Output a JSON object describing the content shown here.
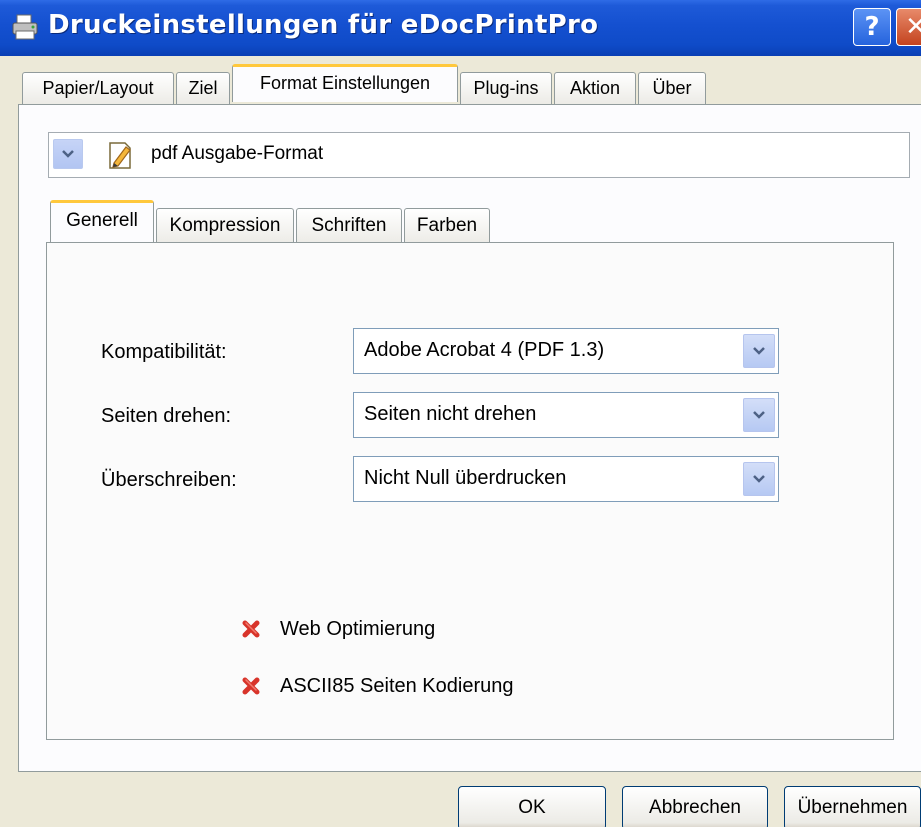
{
  "window": {
    "title": "Druckeinstellungen für eDocPrintPro",
    "help_label": "?",
    "close_label": "✕"
  },
  "outer_tabs": [
    {
      "label": "Papier/Layout",
      "active": false
    },
    {
      "label": "Ziel",
      "active": false
    },
    {
      "label": "Format Einstellungen",
      "active": true
    },
    {
      "label": "Plug-ins",
      "active": false
    },
    {
      "label": "Aktion",
      "active": false
    },
    {
      "label": "Über",
      "active": false
    }
  ],
  "format_selector": {
    "label": "pdf Ausgabe-Format",
    "icon": "pdf-edit-icon"
  },
  "inner_tabs": [
    {
      "label": "Generell",
      "active": true
    },
    {
      "label": "Kompression",
      "active": false
    },
    {
      "label": "Schriften",
      "active": false
    },
    {
      "label": "Farben",
      "active": false
    }
  ],
  "fields": {
    "compat": {
      "label": "Kompatibilität:",
      "value": "Adobe Acrobat 4 (PDF 1.3)"
    },
    "rotate": {
      "label": "Seiten drehen:",
      "value": "Seiten nicht drehen"
    },
    "overprint": {
      "label": "Überschreiben:",
      "value": "Nicht Null überdrucken"
    }
  },
  "options": {
    "web": {
      "label": "Web Optimierung",
      "state": "disabled",
      "icon": "red-x-icon"
    },
    "ascii": {
      "label": "ASCII85 Seiten Kodierung",
      "state": "disabled",
      "icon": "red-x-icon"
    }
  },
  "buttons": {
    "ok": "OK",
    "cancel": "Abbrechen",
    "apply": "Übernehmen"
  },
  "colors": {
    "titlebar": "#0F4BC8",
    "dialog_bg": "#ECE9D8",
    "active_tab_accent": "#FFC83C",
    "red_x": "#D8342A"
  }
}
